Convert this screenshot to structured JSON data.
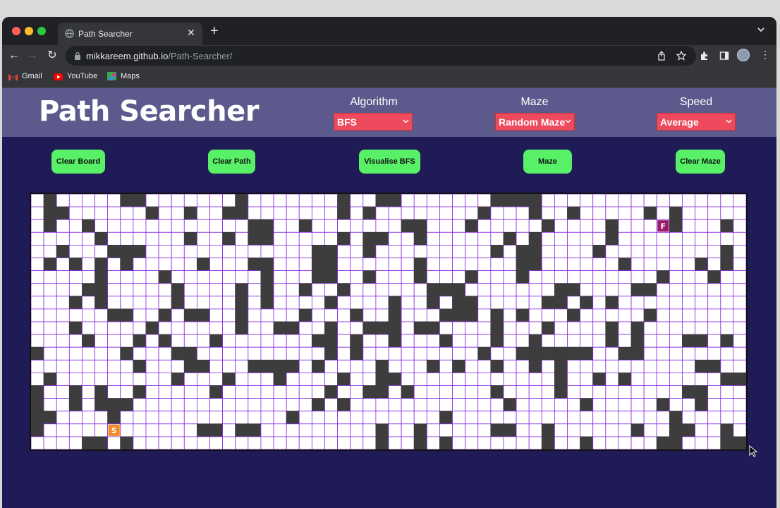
{
  "browser": {
    "tab_title": "Path Searcher",
    "url_host": "mikkareem.github.io",
    "url_path": "/Path-Searcher/",
    "new_tab_label": "+",
    "bookmarks": [
      {
        "label": "Gmail",
        "icon": "gmail-icon"
      },
      {
        "label": "YouTube",
        "icon": "youtube-icon"
      },
      {
        "label": "Maps",
        "icon": "maps-icon"
      }
    ],
    "colors": {
      "frame": "#202124",
      "toolbar": "#35363a",
      "text": "#e8eaed"
    }
  },
  "app": {
    "logo": "Path Searcher",
    "controls": [
      {
        "label": "Algorithm",
        "value": "BFS"
      },
      {
        "label": "Maze",
        "value": "Random Maze"
      },
      {
        "label": "Speed",
        "value": "Average"
      }
    ],
    "buttons": [
      "Clear Board",
      "Clear Path",
      "Visualise BFS",
      "Maze",
      "Clear Maze"
    ],
    "colors": {
      "header": "#5c5a8c",
      "page": "#1e1b56",
      "select": "#ee4a5e",
      "button": "#58f067",
      "wall": "#3d3d3d",
      "grid_line": "#8a2be2",
      "start": "#f08a24",
      "finish": "#9b1a6e"
    }
  },
  "grid": {
    "cols": 56,
    "rows": 20,
    "start": {
      "label": "S",
      "row": 18,
      "col": 6
    },
    "finish": {
      "label": "F",
      "row": 2,
      "col": 49
    },
    "walls": [
      [
        0,
        1
      ],
      [
        0,
        7
      ],
      [
        0,
        8
      ],
      [
        0,
        16
      ],
      [
        0,
        24
      ],
      [
        0,
        27
      ],
      [
        0,
        28
      ],
      [
        0,
        36
      ],
      [
        0,
        37
      ],
      [
        0,
        38
      ],
      [
        0,
        39
      ],
      [
        1,
        1
      ],
      [
        1,
        2
      ],
      [
        1,
        9
      ],
      [
        1,
        12
      ],
      [
        1,
        15
      ],
      [
        1,
        16
      ],
      [
        1,
        24
      ],
      [
        1,
        26
      ],
      [
        1,
        35
      ],
      [
        1,
        39
      ],
      [
        1,
        42
      ],
      [
        1,
        48
      ],
      [
        1,
        50
      ],
      [
        2,
        1
      ],
      [
        2,
        4
      ],
      [
        2,
        17
      ],
      [
        2,
        18
      ],
      [
        2,
        21
      ],
      [
        2,
        29
      ],
      [
        2,
        30
      ],
      [
        2,
        34
      ],
      [
        2,
        40
      ],
      [
        2,
        45
      ],
      [
        2,
        50
      ],
      [
        2,
        54
      ],
      [
        3,
        5
      ],
      [
        3,
        12
      ],
      [
        3,
        15
      ],
      [
        3,
        17
      ],
      [
        3,
        18
      ],
      [
        3,
        24
      ],
      [
        3,
        26
      ],
      [
        3,
        27
      ],
      [
        3,
        30
      ],
      [
        3,
        37
      ],
      [
        3,
        39
      ],
      [
        3,
        45
      ],
      [
        4,
        2
      ],
      [
        4,
        6
      ],
      [
        4,
        7
      ],
      [
        4,
        8
      ],
      [
        4,
        22
      ],
      [
        4,
        23
      ],
      [
        4,
        26
      ],
      [
        4,
        36
      ],
      [
        4,
        38
      ],
      [
        4,
        39
      ],
      [
        4,
        44
      ],
      [
        4,
        54
      ],
      [
        5,
        1
      ],
      [
        5,
        3
      ],
      [
        5,
        5
      ],
      [
        5,
        7
      ],
      [
        5,
        13
      ],
      [
        5,
        17
      ],
      [
        5,
        18
      ],
      [
        5,
        22
      ],
      [
        5,
        23
      ],
      [
        5,
        30
      ],
      [
        5,
        38
      ],
      [
        5,
        39
      ],
      [
        5,
        46
      ],
      [
        5,
        52
      ],
      [
        5,
        54
      ],
      [
        6,
        5
      ],
      [
        6,
        10
      ],
      [
        6,
        18
      ],
      [
        6,
        22
      ],
      [
        6,
        23
      ],
      [
        6,
        26
      ],
      [
        6,
        30
      ],
      [
        6,
        34
      ],
      [
        6,
        38
      ],
      [
        6,
        49
      ],
      [
        6,
        53
      ],
      [
        7,
        4
      ],
      [
        7,
        5
      ],
      [
        7,
        11
      ],
      [
        7,
        16
      ],
      [
        7,
        18
      ],
      [
        7,
        21
      ],
      [
        7,
        24
      ],
      [
        7,
        31
      ],
      [
        7,
        32
      ],
      [
        7,
        33
      ],
      [
        7,
        41
      ],
      [
        7,
        42
      ],
      [
        7,
        47
      ],
      [
        7,
        48
      ],
      [
        8,
        3
      ],
      [
        8,
        5
      ],
      [
        8,
        11
      ],
      [
        8,
        16
      ],
      [
        8,
        18
      ],
      [
        8,
        23
      ],
      [
        8,
        28
      ],
      [
        8,
        31
      ],
      [
        8,
        33
      ],
      [
        8,
        34
      ],
      [
        8,
        40
      ],
      [
        8,
        41
      ],
      [
        8,
        43
      ],
      [
        8,
        45
      ],
      [
        9,
        6
      ],
      [
        9,
        7
      ],
      [
        9,
        10
      ],
      [
        9,
        12
      ],
      [
        9,
        13
      ],
      [
        9,
        16
      ],
      [
        9,
        21
      ],
      [
        9,
        25
      ],
      [
        9,
        28
      ],
      [
        9,
        32
      ],
      [
        9,
        33
      ],
      [
        9,
        34
      ],
      [
        9,
        36
      ],
      [
        9,
        38
      ],
      [
        9,
        42
      ],
      [
        9,
        48
      ],
      [
        10,
        3
      ],
      [
        10,
        9
      ],
      [
        10,
        16
      ],
      [
        10,
        19
      ],
      [
        10,
        20
      ],
      [
        10,
        23
      ],
      [
        10,
        26
      ],
      [
        10,
        27
      ],
      [
        10,
        28
      ],
      [
        10,
        30
      ],
      [
        10,
        31
      ],
      [
        10,
        36
      ],
      [
        10,
        40
      ],
      [
        10,
        45
      ],
      [
        10,
        47
      ],
      [
        11,
        4
      ],
      [
        11,
        8
      ],
      [
        11,
        10
      ],
      [
        11,
        14
      ],
      [
        11,
        22
      ],
      [
        11,
        23
      ],
      [
        11,
        25
      ],
      [
        11,
        28
      ],
      [
        11,
        32
      ],
      [
        11,
        36
      ],
      [
        11,
        39
      ],
      [
        11,
        45
      ],
      [
        11,
        47
      ],
      [
        11,
        51
      ],
      [
        11,
        52
      ],
      [
        11,
        54
      ],
      [
        12,
        0
      ],
      [
        12,
        7
      ],
      [
        12,
        11
      ],
      [
        12,
        12
      ],
      [
        12,
        23
      ],
      [
        12,
        25
      ],
      [
        12,
        35
      ],
      [
        12,
        38
      ],
      [
        12,
        39
      ],
      [
        12,
        40
      ],
      [
        12,
        41
      ],
      [
        12,
        42
      ],
      [
        12,
        43
      ],
      [
        12,
        46
      ],
      [
        12,
        47
      ],
      [
        13,
        8
      ],
      [
        13,
        12
      ],
      [
        13,
        13
      ],
      [
        13,
        17
      ],
      [
        13,
        18
      ],
      [
        13,
        19
      ],
      [
        13,
        20
      ],
      [
        13,
        22
      ],
      [
        13,
        27
      ],
      [
        13,
        31
      ],
      [
        13,
        33
      ],
      [
        13,
        36
      ],
      [
        13,
        39
      ],
      [
        13,
        41
      ],
      [
        13,
        52
      ],
      [
        13,
        53
      ],
      [
        14,
        1
      ],
      [
        14,
        11
      ],
      [
        14,
        15
      ],
      [
        14,
        19
      ],
      [
        14,
        24
      ],
      [
        14,
        27
      ],
      [
        14,
        28
      ],
      [
        14,
        41
      ],
      [
        14,
        44
      ],
      [
        14,
        46
      ],
      [
        14,
        54
      ],
      [
        14,
        55
      ],
      [
        15,
        0
      ],
      [
        15,
        3
      ],
      [
        15,
        5
      ],
      [
        15,
        8
      ],
      [
        15,
        14
      ],
      [
        15,
        23
      ],
      [
        15,
        26
      ],
      [
        15,
        27
      ],
      [
        15,
        29
      ],
      [
        15,
        36
      ],
      [
        15,
        41
      ],
      [
        15,
        51
      ],
      [
        15,
        52
      ],
      [
        16,
        0
      ],
      [
        16,
        3
      ],
      [
        16,
        5
      ],
      [
        16,
        6
      ],
      [
        16,
        7
      ],
      [
        16,
        22
      ],
      [
        16,
        24
      ],
      [
        16,
        37
      ],
      [
        16,
        43
      ],
      [
        16,
        49
      ],
      [
        16,
        52
      ],
      [
        17,
        0
      ],
      [
        17,
        1
      ],
      [
        17,
        6
      ],
      [
        17,
        20
      ],
      [
        17,
        32
      ],
      [
        17,
        50
      ],
      [
        18,
        0
      ],
      [
        18,
        13
      ],
      [
        18,
        14
      ],
      [
        18,
        16
      ],
      [
        18,
        17
      ],
      [
        18,
        27
      ],
      [
        18,
        30
      ],
      [
        18,
        36
      ],
      [
        18,
        37
      ],
      [
        18,
        40
      ],
      [
        18,
        47
      ],
      [
        18,
        50
      ],
      [
        18,
        51
      ],
      [
        18,
        54
      ],
      [
        19,
        4
      ],
      [
        19,
        5
      ],
      [
        19,
        7
      ],
      [
        19,
        27
      ],
      [
        19,
        30
      ],
      [
        19,
        32
      ],
      [
        19,
        40
      ],
      [
        19,
        43
      ],
      [
        19,
        49
      ],
      [
        19,
        50
      ],
      [
        19,
        54
      ],
      [
        19,
        55
      ]
    ]
  }
}
